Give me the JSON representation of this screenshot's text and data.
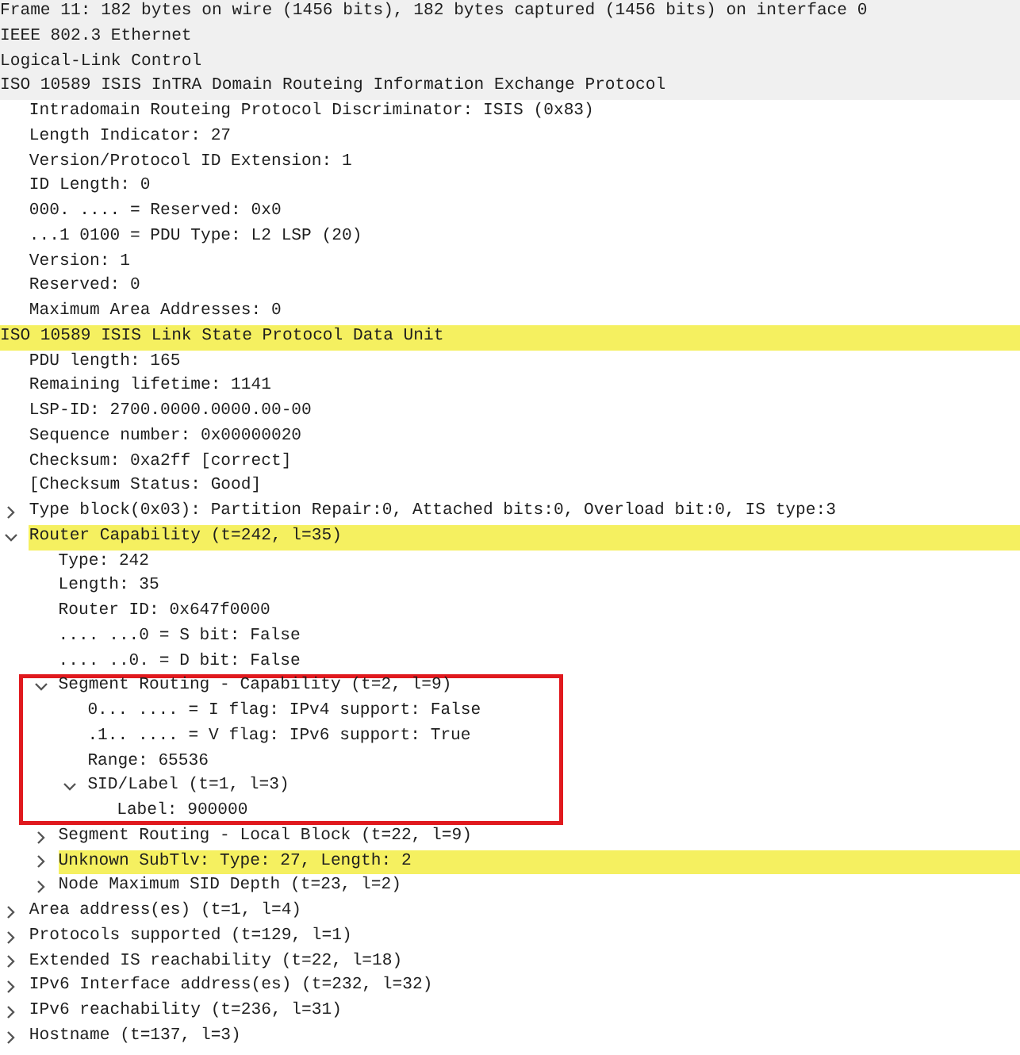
{
  "tree": [
    {
      "text": "Frame 11: 182 bytes on wire (1456 bits), 182 bytes captured (1456 bits) on interface 0",
      "shaded": true,
      "highlighted": false
    },
    {
      "text": "IEEE 802.3 Ethernet",
      "shaded": true,
      "highlighted": false
    },
    {
      "text": "Logical-Link Control",
      "shaded": true,
      "highlighted": false
    },
    {
      "text": "ISO 10589 ISIS InTRA Domain Routeing Information Exchange Protocol",
      "shaded": true,
      "highlighted": false,
      "children": [
        {
          "text": "Intradomain Routeing Protocol Discriminator: ISIS (0x83)",
          "highlighted": false
        },
        {
          "text": "Length Indicator: 27",
          "highlighted": false
        },
        {
          "text": "Version/Protocol ID Extension: 1",
          "highlighted": false
        },
        {
          "text": "ID Length: 0",
          "highlighted": false
        },
        {
          "text": "000. .... = Reserved: 0x0",
          "highlighted": false
        },
        {
          "text": "...1 0100 = PDU Type: L2 LSP (20)",
          "highlighted": false
        },
        {
          "text": "Version: 1",
          "highlighted": false
        },
        {
          "text": "Reserved: 0",
          "highlighted": false
        },
        {
          "text": "Maximum Area Addresses: 0",
          "highlighted": false
        }
      ]
    },
    {
      "text": "ISO 10589 ISIS Link State Protocol Data Unit",
      "shaded": true,
      "highlighted": true,
      "children": [
        {
          "text": "PDU length: 165",
          "highlighted": false
        },
        {
          "text": "Remaining lifetime: 1141",
          "highlighted": false
        },
        {
          "text": "LSP-ID: 2700.0000.0000.00-00",
          "highlighted": false
        },
        {
          "text": "Sequence number: 0x00000020",
          "highlighted": false
        },
        {
          "text": "Checksum: 0xa2ff [correct]",
          "highlighted": false
        },
        {
          "text": "[Checksum Status: Good]",
          "highlighted": false
        },
        {
          "text": "Type block(0x03): Partition Repair:0, Attached bits:0, Overload bit:0, IS type:3",
          "highlighted": false,
          "expanded": false
        },
        {
          "text": "Router Capability (t=242, l=35)",
          "highlighted": true,
          "expanded": true,
          "children": [
            {
              "text": "Type: 242",
              "highlighted": false
            },
            {
              "text": "Length: 35",
              "highlighted": false
            },
            {
              "text": "Router ID: 0x647f0000",
              "highlighted": false
            },
            {
              "text": ".... ...0 = S bit: False",
              "highlighted": false
            },
            {
              "text": ".... ..0. = D bit: False",
              "highlighted": false
            },
            {
              "text": "Segment Routing - Capability (t=2, l=9)",
              "highlighted": false,
              "expanded": true,
              "boxed": true,
              "children": [
                {
                  "text": "0... .... = I flag: IPv4 support: False",
                  "highlighted": false
                },
                {
                  "text": ".1.. .... = V flag: IPv6 support: True",
                  "highlighted": false
                },
                {
                  "text": "Range: 65536",
                  "highlighted": false
                },
                {
                  "text": "SID/Label (t=1, l=3)",
                  "highlighted": false,
                  "expanded": true,
                  "children": [
                    {
                      "text": "Label: 900000",
                      "highlighted": false
                    }
                  ]
                }
              ]
            },
            {
              "text": "Segment Routing - Local Block (t=22, l=9)",
              "highlighted": false,
              "expanded": false
            },
            {
              "text": "Unknown SubTlv: Type: 27, Length: 2",
              "highlighted": true,
              "expanded": false
            },
            {
              "text": "Node Maximum SID Depth (t=23, l=2)",
              "highlighted": false,
              "expanded": false
            }
          ]
        },
        {
          "text": "Area address(es) (t=1, l=4)",
          "highlighted": false,
          "expanded": false
        },
        {
          "text": "Protocols supported (t=129, l=1)",
          "highlighted": false,
          "expanded": false
        },
        {
          "text": "Extended IS reachability (t=22, l=18)",
          "highlighted": false,
          "expanded": false
        },
        {
          "text": "IPv6 Interface address(es) (t=232, l=32)",
          "highlighted": false,
          "expanded": false
        },
        {
          "text": "IPv6 reachability (t=236, l=31)",
          "highlighted": false,
          "expanded": false
        },
        {
          "text": "Hostname (t=137, l=3)",
          "highlighted": false,
          "expanded": false
        }
      ]
    }
  ]
}
